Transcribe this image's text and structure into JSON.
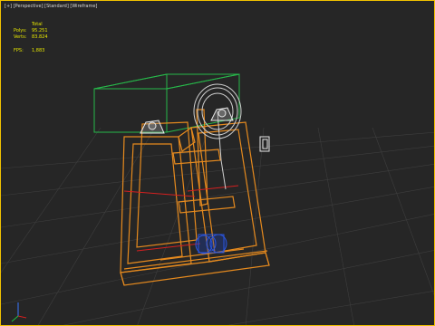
{
  "viewport": {
    "label_parts": [
      "[+]",
      "[Perspective]",
      "[Standard]",
      "[Wireframe]"
    ],
    "border_color": "#f2c200",
    "background": "#262626"
  },
  "stats": {
    "total_header": "Total",
    "polys_key": "Polys:",
    "polys_value": "95.251",
    "verts_key": "Verts:",
    "verts_value": "83.824",
    "fps_key": "FPS:",
    "fps_value": "1,883"
  },
  "scene": {
    "wire_colors": {
      "frame": "#e68a1e",
      "box": "#27b84a",
      "wheel": "#cfcfcf",
      "motor": "#2a55e0",
      "rod": "#d42020",
      "grid": "#4a4a4a"
    }
  }
}
